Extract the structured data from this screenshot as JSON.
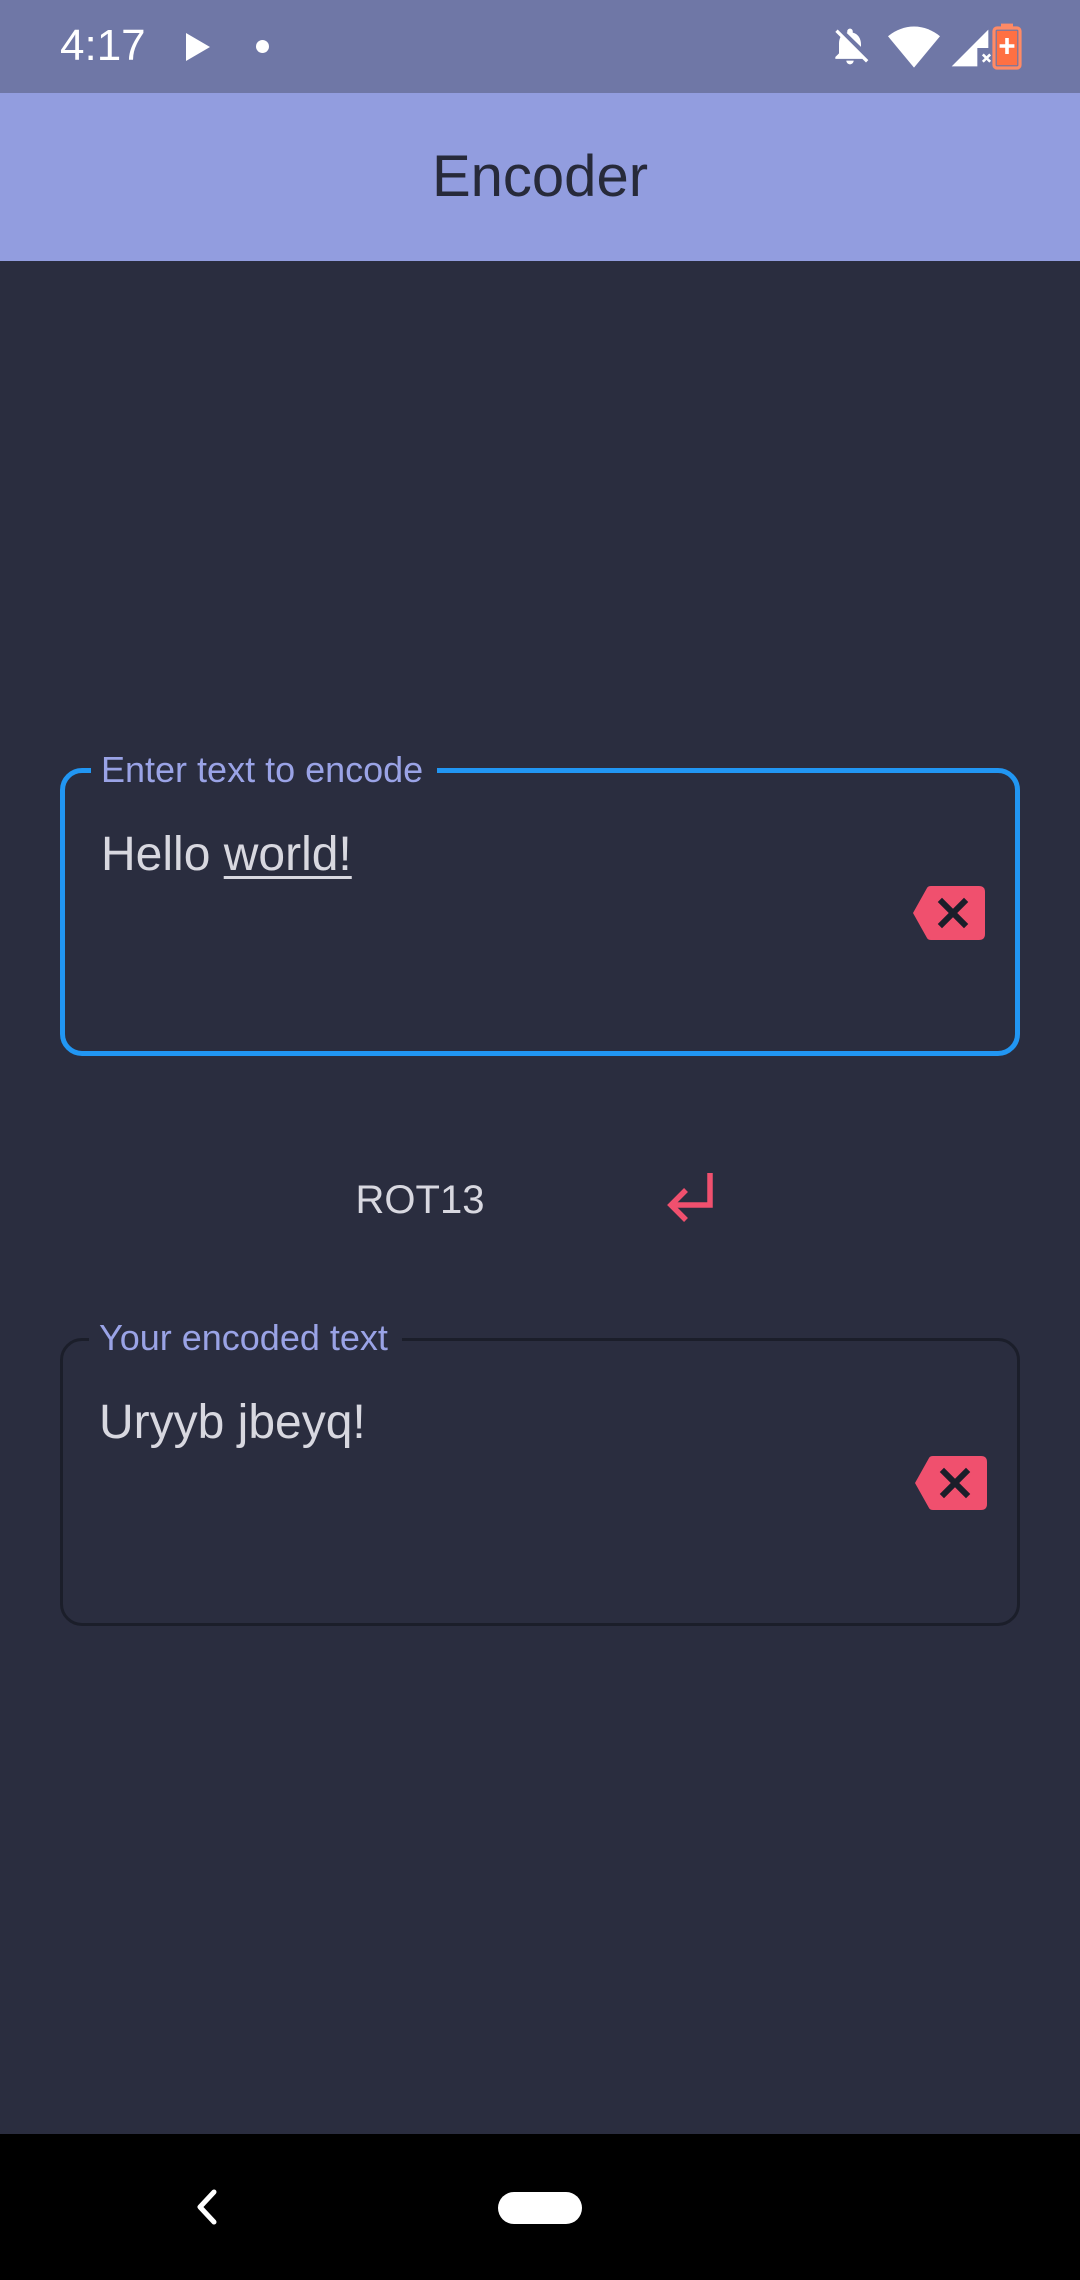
{
  "status_bar": {
    "time": "4:17",
    "icons": [
      "play-icon",
      "notification-dot-icon",
      "notifications-off-icon",
      "wifi-icon",
      "cellular-signal-icon",
      "battery-charging-icon"
    ]
  },
  "app_bar": {
    "title": "Encoder"
  },
  "input_field": {
    "label": "Enter text to encode",
    "value_plain": "Hello ",
    "value_underlined": "world!",
    "clear_icon": "backspace-clear-icon"
  },
  "cipher": {
    "name": "ROT13",
    "action_icon": "enter-return-arrow-icon"
  },
  "output_field": {
    "label": "Your encoded text",
    "value": "Uryyb jbeyq!",
    "clear_icon": "backspace-clear-icon"
  },
  "nav_bar": {
    "icons": [
      "back-icon",
      "home-pill-icon"
    ]
  },
  "colors": {
    "status_bar": "#6f77a6",
    "app_bar": "#929ddf",
    "background": "#2a2d3f",
    "focused_border": "#2196f3",
    "label": "#9aa3e6",
    "accent": "#f0506e",
    "text": "#d8d8e0"
  }
}
